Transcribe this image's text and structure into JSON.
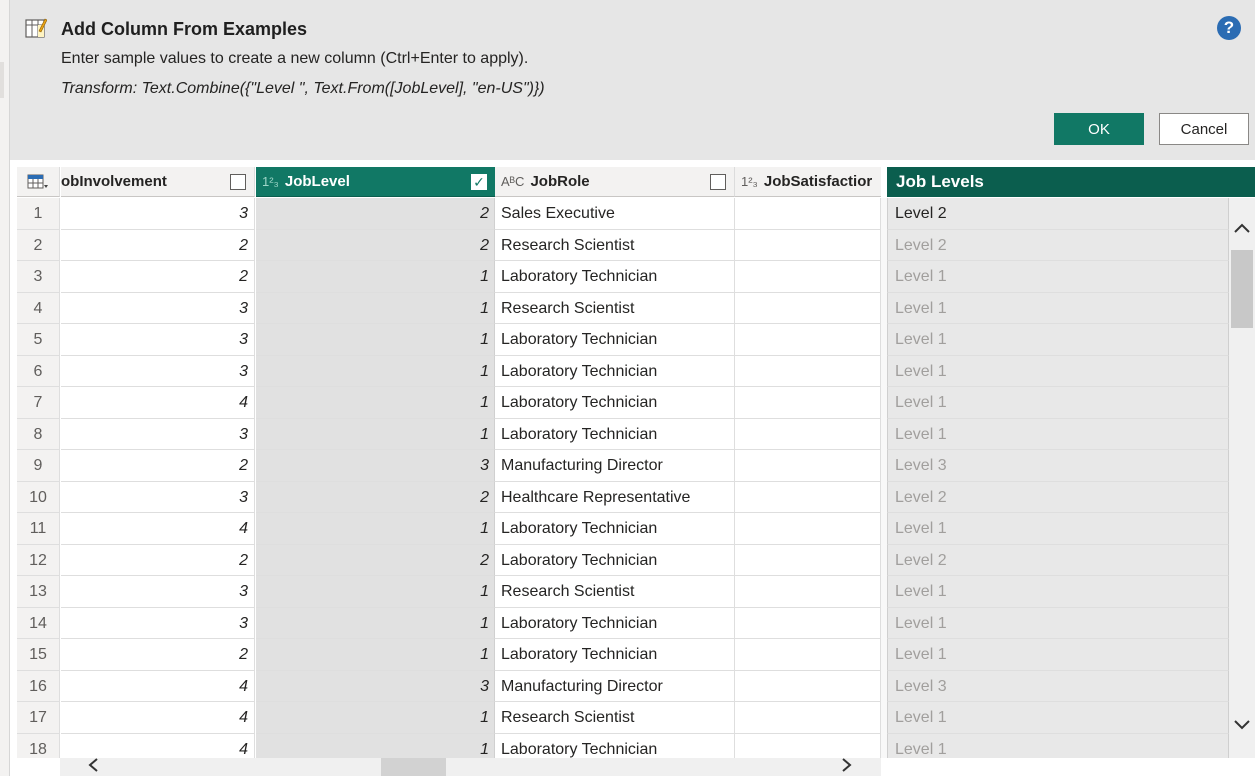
{
  "dialog": {
    "title": "Add Column From Examples",
    "subtitle": "Enter sample values to create a new column (Ctrl+Enter to apply).",
    "transform": "Transform: Text.Combine({\"Level \", Text.From([JobLevel], \"en-US\")})",
    "help_label": "?",
    "ok_label": "OK",
    "cancel_label": "Cancel"
  },
  "columns": {
    "involvement": {
      "label": "obInvolvement",
      "checked": false
    },
    "joblevel": {
      "label": "JobLevel",
      "type_icon": "1²₃",
      "checked": true
    },
    "jobrole": {
      "label": "JobRole",
      "type_icon": "AᴮC",
      "checked": false
    },
    "jobsat": {
      "label": "JobSatisfactior",
      "type_icon": "1²₃"
    },
    "output": {
      "label": "Job Levels"
    }
  },
  "rows": [
    {
      "idx": "1",
      "inv": "3",
      "lvl": "2",
      "role": "Sales Executive",
      "out": "Level 2"
    },
    {
      "idx": "2",
      "inv": "2",
      "lvl": "2",
      "role": "Research Scientist",
      "out": "Level 2"
    },
    {
      "idx": "3",
      "inv": "2",
      "lvl": "1",
      "role": "Laboratory Technician",
      "out": "Level 1"
    },
    {
      "idx": "4",
      "inv": "3",
      "lvl": "1",
      "role": "Research Scientist",
      "out": "Level 1"
    },
    {
      "idx": "5",
      "inv": "3",
      "lvl": "1",
      "role": "Laboratory Technician",
      "out": "Level 1"
    },
    {
      "idx": "6",
      "inv": "3",
      "lvl": "1",
      "role": "Laboratory Technician",
      "out": "Level 1"
    },
    {
      "idx": "7",
      "inv": "4",
      "lvl": "1",
      "role": "Laboratory Technician",
      "out": "Level 1"
    },
    {
      "idx": "8",
      "inv": "3",
      "lvl": "1",
      "role": "Laboratory Technician",
      "out": "Level 1"
    },
    {
      "idx": "9",
      "inv": "2",
      "lvl": "3",
      "role": "Manufacturing Director",
      "out": "Level 3"
    },
    {
      "idx": "10",
      "inv": "3",
      "lvl": "2",
      "role": "Healthcare Representative",
      "out": "Level 2"
    },
    {
      "idx": "11",
      "inv": "4",
      "lvl": "1",
      "role": "Laboratory Technician",
      "out": "Level 1"
    },
    {
      "idx": "12",
      "inv": "2",
      "lvl": "2",
      "role": "Laboratory Technician",
      "out": "Level 2"
    },
    {
      "idx": "13",
      "inv": "3",
      "lvl": "1",
      "role": "Research Scientist",
      "out": "Level 1"
    },
    {
      "idx": "14",
      "inv": "3",
      "lvl": "1",
      "role": "Laboratory Technician",
      "out": "Level 1"
    },
    {
      "idx": "15",
      "inv": "2",
      "lvl": "1",
      "role": "Laboratory Technician",
      "out": "Level 1"
    },
    {
      "idx": "16",
      "inv": "4",
      "lvl": "3",
      "role": "Manufacturing Director",
      "out": "Level 3"
    },
    {
      "idx": "17",
      "inv": "4",
      "lvl": "1",
      "role": "Research Scientist",
      "out": "Level 1"
    },
    {
      "idx": "18",
      "inv": "4",
      "lvl": "1",
      "role": "Laboratory Technician",
      "out": "Level 1"
    }
  ],
  "colors": {
    "accent": "#117865",
    "output_header": "#0b5e4e",
    "help": "#2b6cb3"
  }
}
